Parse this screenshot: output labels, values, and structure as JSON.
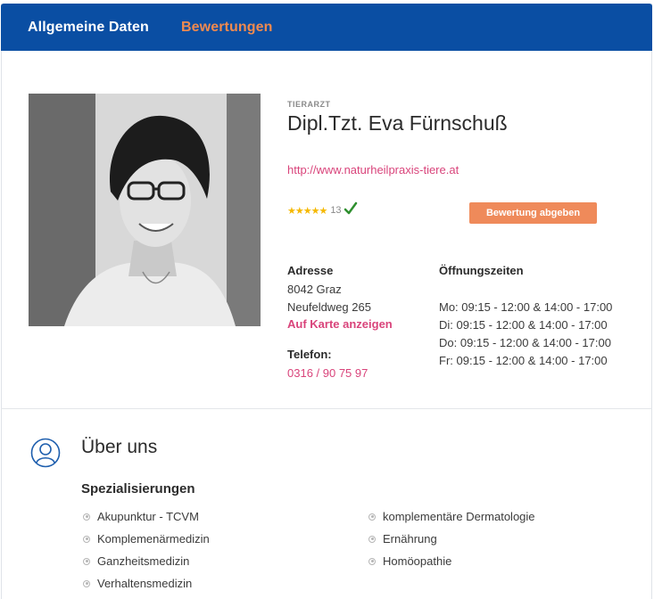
{
  "tabs": {
    "general": "Allgemeine Daten",
    "reviews": "Bewertungen"
  },
  "profile": {
    "category": "TIERARZT",
    "name": "Dipl.Tzt. Eva Fürnschuß",
    "website": "http://www.naturheilpraxis-tiere.at",
    "rating": {
      "stars": "★★★★★",
      "count": "13",
      "verified_icon": "check-icon"
    },
    "rate_button": "Bewertung abgeben"
  },
  "address": {
    "label": "Adresse",
    "line1": "8042 Graz",
    "line2": "Neufeldweg 265",
    "map_link": "Auf Karte anzeigen"
  },
  "phone": {
    "label": "Telefon:",
    "value": "0316 / 90 75 97"
  },
  "hours": {
    "label": "Öffnungszeiten",
    "lines": [
      "Mo: 09:15 - 12:00 & 14:00 - 17:00",
      "Di: 09:15 - 12:00 & 14:00 - 17:00",
      "Do: 09:15 - 12:00 & 14:00 - 17:00",
      "Fr: 09:15 - 12:00 & 14:00 - 17:00"
    ]
  },
  "about": {
    "title": "Über uns",
    "icon": "user-icon",
    "specializations_title": "Spezialisierungen",
    "specializations": [
      "Akupunktur - TCVM",
      "Komplemenärmedizin",
      "Ganzheitsmedizin",
      "Verhaltensmedizin",
      "komplementäre Dermatologie",
      "Ernährung",
      "Homöopathie"
    ]
  },
  "colors": {
    "header_blue": "#0a4ea3",
    "accent_orange": "#f08a4f",
    "link_pink": "#d9447b",
    "star_gold": "#f5b800",
    "check_green": "#2f8f2f"
  }
}
